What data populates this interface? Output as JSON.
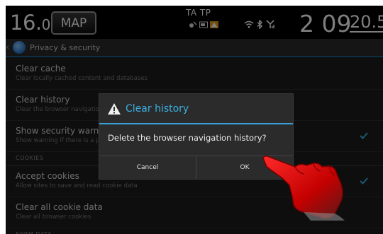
{
  "statusbar": {
    "freq_int": "16.",
    "freq_dec": "0",
    "map_label": "MAP",
    "tatp": "TA TP",
    "clock": "2 09",
    "temp": "20.5"
  },
  "icons": {
    "mini": [
      "satellite-icon",
      "card-icon",
      "warning-triangle-icon"
    ],
    "conn": [
      "wifi-icon",
      "bluetooth-icon",
      "signal-icon"
    ],
    "accent": "#3aaee0"
  },
  "actionbar": {
    "title": "Privacy & security"
  },
  "list": {
    "items": [
      {
        "title": "Clear cache",
        "subtitle": "Clear locally cached content and databases"
      },
      {
        "title": "Clear history",
        "subtitle": "Clear the browser navigation history"
      },
      {
        "title": "Show security warnings",
        "subtitle": "Show warning if there is a problem with a site's security"
      }
    ],
    "section_cookies": "COOKIES",
    "cookie_items": [
      {
        "title": "Accept cookies",
        "subtitle": "Allow sites to save and read cookie data"
      },
      {
        "title": "Clear all cookie data",
        "subtitle": "Clear all browser cookies"
      }
    ],
    "section_form": "FORM DATA"
  },
  "dialog": {
    "title": "Clear history",
    "message": "Delete the browser navigation history?",
    "cancel": "Cancel",
    "ok": "OK"
  }
}
